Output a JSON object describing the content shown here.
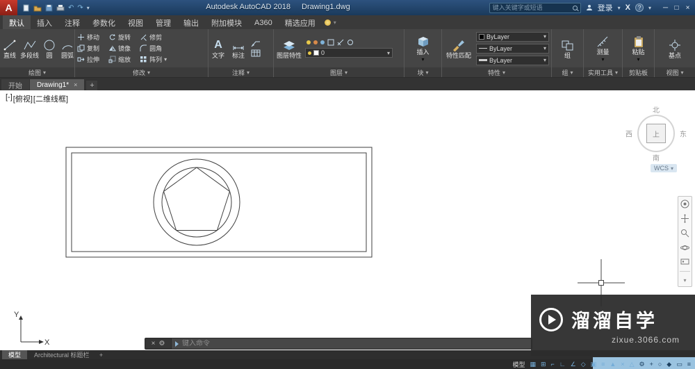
{
  "titlebar": {
    "logo_letter": "A",
    "app_title": "Autodesk AutoCAD 2018",
    "doc_title": "Drawing1.dwg",
    "search_placeholder": "键入关键字或短语",
    "signin_label": "登录",
    "exchange_label": "X",
    "help_label": "?",
    "window": {
      "minimize": "─",
      "restore": "□",
      "close": "×"
    }
  },
  "ribbon": {
    "tabs": [
      {
        "label": "默认"
      },
      {
        "label": "插入"
      },
      {
        "label": "注释"
      },
      {
        "label": "参数化"
      },
      {
        "label": "视图"
      },
      {
        "label": "管理"
      },
      {
        "label": "输出"
      },
      {
        "label": "附加模块"
      },
      {
        "label": "A360"
      },
      {
        "label": "精选应用"
      }
    ],
    "panels": {
      "draw": {
        "title": "绘图",
        "tools": [
          "直线",
          "多段线",
          "圆",
          "圆弧"
        ]
      },
      "modify": {
        "title": "修改",
        "tools": [
          "移动",
          "旋转",
          "修剪",
          "复制",
          "镜像",
          "圆角",
          "拉伸",
          "缩放",
          "阵列"
        ]
      },
      "annotate": {
        "title": "注释",
        "text_label": "文字",
        "dim_label": "标注"
      },
      "layers": {
        "title": "图层",
        "properties_label": "图层特性",
        "current_layer": "0"
      },
      "block": {
        "title": "块",
        "insert_label": "插入"
      },
      "properties": {
        "title": "特性",
        "match_label": "特性匹配",
        "color": "ByLayer",
        "linetype": "ByLayer",
        "lineweight": "ByLayer"
      },
      "groups": {
        "title": "组",
        "group_label": "组"
      },
      "utilities": {
        "title": "实用工具",
        "measure_label": "测量"
      },
      "clipboard": {
        "title": "剪贴板",
        "paste_label": "粘贴"
      },
      "view": {
        "title": "视图",
        "base_label": "基点"
      }
    }
  },
  "file_tabs": {
    "start": "开始",
    "active_doc": "Drawing1*",
    "close": "×",
    "add": "+"
  },
  "canvas": {
    "viewport_controls": [
      "[-]",
      "[俯视]",
      "[二维线框]"
    ],
    "viewcube": {
      "north": "北",
      "south": "南",
      "west": "西",
      "east": "东",
      "top": "上",
      "wcs": "WCS"
    },
    "ucs": {
      "x": "X",
      "y": "Y"
    },
    "command_line": {
      "close": "×",
      "customize": "⚙",
      "placeholder": "键入命令"
    },
    "watermark": {
      "brand": "溜溜自学",
      "url": "zixue.3066.com"
    }
  },
  "layout_tabs": {
    "model": "模型",
    "layout1": "Architectural 标题栏",
    "add": "+"
  },
  "statusbar": {
    "model_label": "模型",
    "icons": [
      {
        "name": "grid",
        "glyph": "▦"
      },
      {
        "name": "snap",
        "glyph": "⊞"
      },
      {
        "name": "infer-constraints",
        "glyph": "⌐"
      },
      {
        "name": "ortho",
        "glyph": "∟"
      },
      {
        "name": "polar-tracking",
        "glyph": "∠"
      },
      {
        "name": "isodraft",
        "glyph": "◇"
      },
      {
        "name": "object-snap",
        "glyph": "▣"
      },
      {
        "name": "lineweight",
        "glyph": "≡"
      },
      {
        "name": "annotation-visibility",
        "glyph": "▲"
      },
      {
        "name": "autoscale",
        "glyph": "×"
      },
      {
        "name": "annotation-scale",
        "glyph": "△"
      },
      {
        "name": "workspace-gear",
        "glyph": "⚙"
      },
      {
        "name": "annotation-monitor",
        "glyph": "+"
      },
      {
        "name": "object-isolate",
        "glyph": "○"
      },
      {
        "name": "graphics-performance",
        "glyph": "◆"
      },
      {
        "name": "clean-screen",
        "glyph": "▭"
      },
      {
        "name": "customize",
        "glyph": "≡"
      }
    ]
  }
}
